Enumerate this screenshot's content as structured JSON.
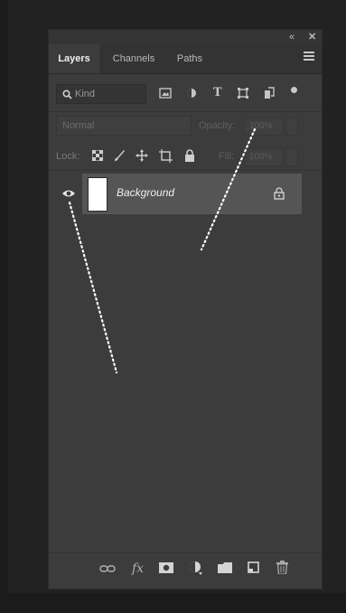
{
  "panel": {
    "titlebar": {
      "collapse_label": "«",
      "close_label": "✕"
    },
    "tabs": [
      {
        "label": "Layers",
        "active": true
      },
      {
        "label": "Channels",
        "active": false
      },
      {
        "label": "Paths",
        "active": false
      }
    ],
    "filter": {
      "placeholder": "Kind",
      "icons": [
        "image-filter-icon",
        "adjustment-filter-icon",
        "type-filter-icon",
        "shape-filter-icon",
        "smart-object-filter-icon",
        "filter-toggle-dot"
      ]
    },
    "blend": {
      "mode": "Normal",
      "opacity_label": "Opacity:",
      "opacity_value": "100%"
    },
    "lock": {
      "label": "Lock:",
      "fill_label": "Fill:",
      "fill_value": "100%"
    },
    "layers": [
      {
        "name": "Background",
        "visible": true,
        "locked": true
      }
    ],
    "bottom_icons": [
      "link-icon",
      "fx-icon",
      "mask-icon",
      "adjustment-layer-icon",
      "folder-icon",
      "new-layer-icon",
      "trash-icon"
    ],
    "fx_label": "fx"
  },
  "colors": {
    "panel_bg": "#3c3c3c",
    "selected_layer": "#555555",
    "text_active": "#f0f0f0"
  }
}
